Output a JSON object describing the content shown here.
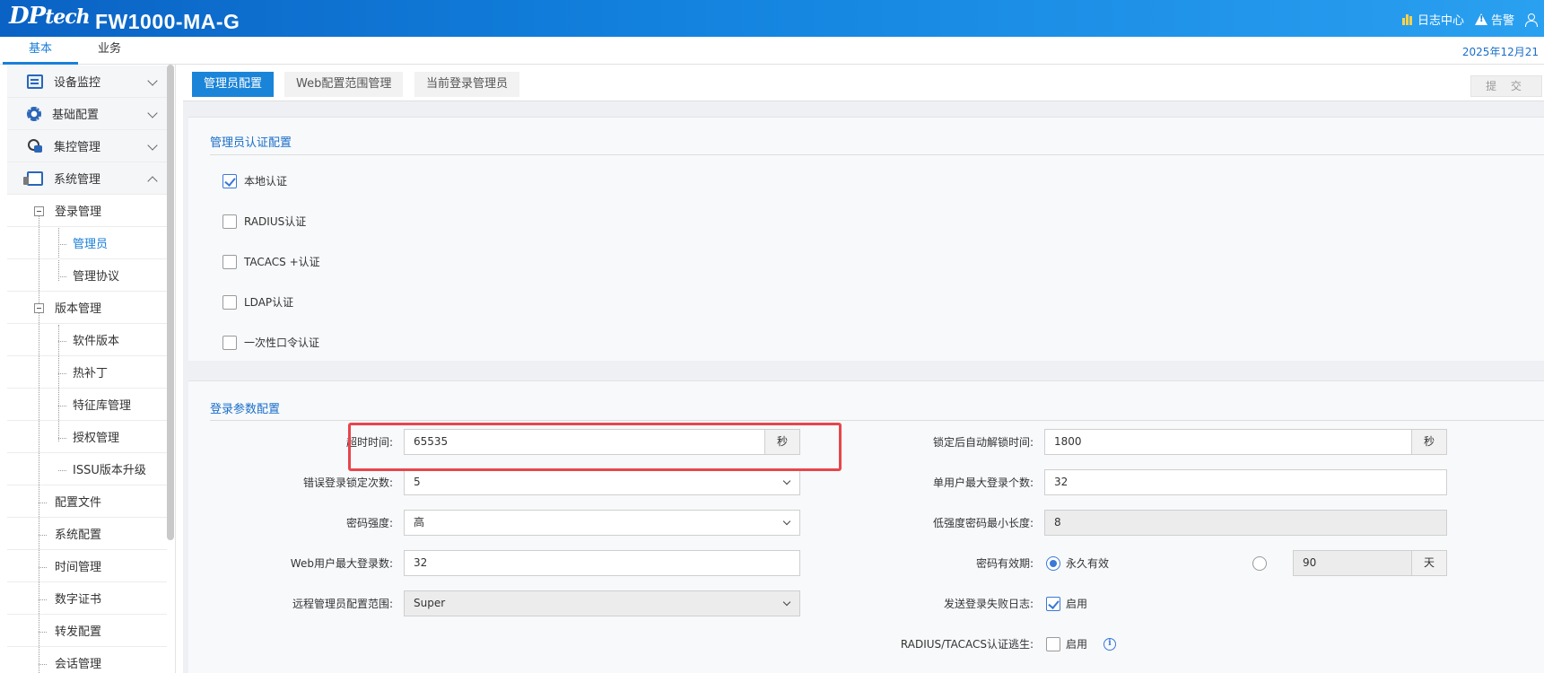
{
  "header": {
    "logo": "DPtech",
    "logo_main": "DP",
    "logo_tail": "tech",
    "model": "FW1000-MA-G",
    "log_center": "日志中心",
    "alarm": "告警"
  },
  "top_tabs": [
    "基本",
    "业务"
  ],
  "date": "2025年12月21",
  "sidebar": {
    "groups": [
      "设备监控",
      "基础配置",
      "集控管理",
      "系统管理"
    ],
    "login_mgmt": "登录管理",
    "login_children": [
      "管理员",
      "管理协议"
    ],
    "version_mgmt": "版本管理",
    "version_children": [
      "软件版本",
      "热补丁",
      "特征库管理",
      "授权管理",
      "ISSU版本升级"
    ],
    "others": [
      "配置文件",
      "系统配置",
      "时间管理",
      "数字证书",
      "转发配置",
      "会话管理"
    ]
  },
  "sub_tabs": [
    "管理员配置",
    "Web配置范围管理",
    "当前登录管理员"
  ],
  "submit_label": "提 交",
  "auth_panel": {
    "title": "管理员认证配置",
    "options": [
      {
        "label": "本地认证",
        "checked": true
      },
      {
        "label": "RADIUS认证",
        "checked": false
      },
      {
        "label": "TACACS +认证",
        "checked": false
      },
      {
        "label": "LDAP认证",
        "checked": false
      },
      {
        "label": "一次性口令认证",
        "checked": false
      }
    ]
  },
  "login_panel": {
    "title": "登录参数配置",
    "timeout": {
      "label": "超时时间:",
      "value": "65535",
      "unit": "秒"
    },
    "lock_count": {
      "label": "错误登录锁定次数:",
      "value": "5"
    },
    "pwd_strength": {
      "label": "密码强度:",
      "value": "高"
    },
    "web_max": {
      "label": "Web用户最大登录数:",
      "value": "32"
    },
    "remote_scope": {
      "label": "远程管理员配置范围:",
      "value": "Super"
    },
    "unlock_time": {
      "label": "锁定后自动解锁时间:",
      "value": "1800",
      "unit": "秒"
    },
    "user_max": {
      "label": "单用户最大登录个数:",
      "value": "32"
    },
    "min_len": {
      "label": "低强度密码最小长度:",
      "value": "8"
    },
    "pwd_valid": {
      "label": "密码有效期:",
      "forever": "永久有效",
      "days_value": "90",
      "days_unit": "天"
    },
    "fail_log": {
      "label": "发送登录失败日志:",
      "enable": "启用"
    },
    "radius_escape": {
      "label": "RADIUS/TACACS认证逃生:",
      "enable": "启用"
    }
  },
  "colors": {
    "accent": "#1a84d8",
    "highlight": "#e8454b",
    "header": "#1383df"
  }
}
